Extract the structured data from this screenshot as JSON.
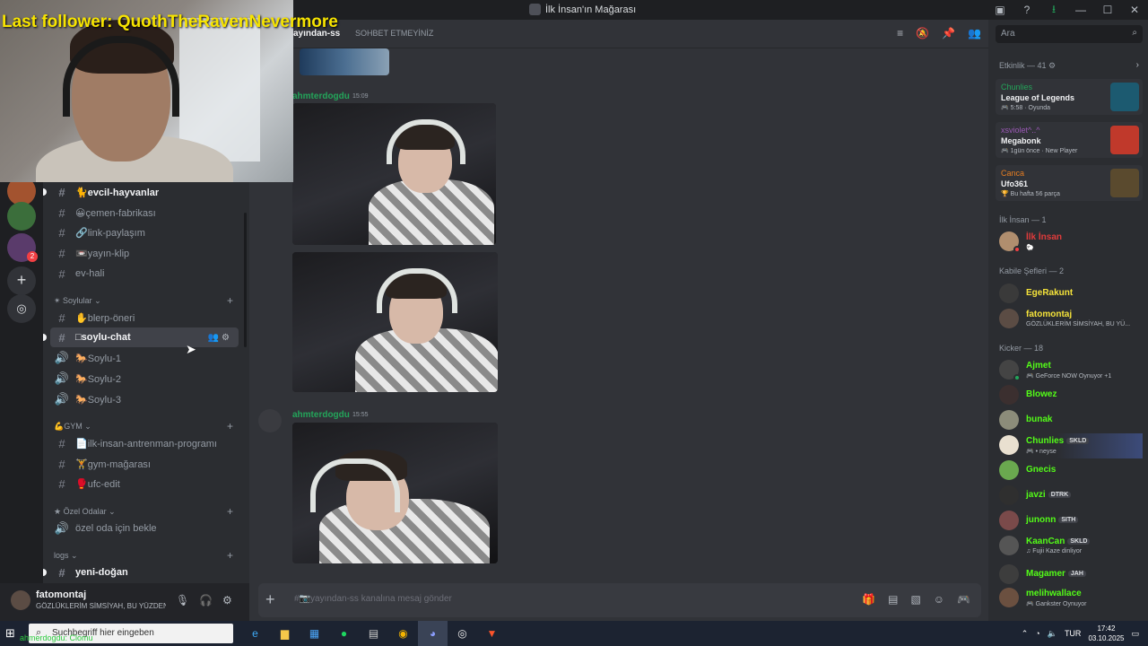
{
  "window": {
    "title": "İlk İnsan'ın Mağarası"
  },
  "overlay": {
    "last_follower": "Last follower: QuothTheRavenNevermore",
    "bottom_text": "ahmerdogdu: Clomu"
  },
  "rail": {
    "badge": "2"
  },
  "channels": [
    {
      "name": "🐈evcil-hayvanlar",
      "type": "text",
      "unread": true
    },
    {
      "name": "😀çemen-fabrikası",
      "type": "text",
      "unread": false
    },
    {
      "name": "🔗link-paylaşım",
      "type": "text",
      "unread": false
    },
    {
      "name": "📼yayın-klip",
      "type": "text",
      "unread": false
    },
    {
      "name": "ev-hali",
      "type": "text",
      "unread": false
    }
  ],
  "categories": {
    "soylular": "✴ Soylular",
    "gym": "💪GYM",
    "ozel": "★ Özel Odalar",
    "logs": "logs"
  },
  "soylular_channels": [
    {
      "name": "✋blerp-öneri",
      "type": "text"
    },
    {
      "name": "□soylu-chat",
      "type": "text",
      "active": true
    },
    {
      "name": "🐎Soylu-1",
      "type": "voice"
    },
    {
      "name": "🐎Soylu-2",
      "type": "voice"
    },
    {
      "name": "🐎Soylu-3",
      "type": "voice"
    }
  ],
  "gym_channels": [
    {
      "name": "📄ilk-insan-antrenman-programı",
      "type": "text"
    },
    {
      "name": "🏋gym-mağarası",
      "type": "text"
    },
    {
      "name": "🥊ufc-edit",
      "type": "text"
    }
  ],
  "ozel_channels": [
    {
      "name": "özel oda için bekle",
      "type": "voice"
    }
  ],
  "logs_channels": [
    {
      "name": "yeni-doğan",
      "type": "text",
      "unread": true
    }
  ],
  "user": {
    "name": "fatomontaj",
    "status": "GÖZLÜKLERİM SİMSİYAH, BU YÜZDEN..."
  },
  "chat": {
    "channel": "ayından-ss",
    "topic": "SOHBET ETMEYİNİZ",
    "messages": [
      {
        "author": "ahmterdogdu",
        "time": "15:09"
      },
      {
        "author": "ahmterdogdu",
        "time": "15:55"
      }
    ],
    "composer_placeholder": "#📷yayından-ss kanalına mesaj gönder"
  },
  "members": {
    "search_placeholder": "Ara",
    "activity_header": "Etkinlik — 41 ⚙",
    "activities": [
      {
        "user": "Chunlies",
        "user_color": "#23a55a",
        "game": "League of Legends",
        "detail": "🎮 5:58 · Oyunda"
      },
      {
        "user": "xsviolet^..^",
        "user_color": "#9b59b6",
        "game": "Megabonk",
        "detail": "🎮 1gün önce · New Player"
      },
      {
        "user": "Canca",
        "user_color": "#e67e22",
        "game": "Ufo361",
        "detail": "🏆 Bu hafta 56 parça"
      }
    ],
    "sections": [
      {
        "title": "İlk İnsan — 1"
      },
      {
        "title": "Kabile Şefleri — 2"
      },
      {
        "title": "Kicker — 18"
      }
    ],
    "ilk_insan": [
      {
        "name": "İlk İnsan",
        "color": "#e03b3b",
        "status": "🐑"
      }
    ],
    "sefler": [
      {
        "name": "EgeRakunt",
        "color": "#f5e33a",
        "status": ""
      },
      {
        "name": "fatomontaj",
        "color": "#f5e33a",
        "status": "GÖZLÜKLERİM SİMSİYAH, BU YÜ..."
      }
    ],
    "kicker": [
      {
        "name": "Ajmet",
        "color": "#53fc18",
        "status": "🎮 GeForce NOW Oynuyor +1",
        "tag": ""
      },
      {
        "name": "Blowez",
        "color": "#53fc18",
        "status": "",
        "tag": ""
      },
      {
        "name": "bunak",
        "color": "#53fc18",
        "status": "",
        "tag": ""
      },
      {
        "name": "Chunlies",
        "color": "#53fc18",
        "status": "🎮 • neyse",
        "tag": "SKLD"
      },
      {
        "name": "Gnecis",
        "color": "#53fc18",
        "status": "",
        "tag": ""
      },
      {
        "name": "javzi",
        "color": "#53fc18",
        "status": "",
        "tag": "DTRK"
      },
      {
        "name": "junonn",
        "color": "#53fc18",
        "status": "",
        "tag": "SITH"
      },
      {
        "name": "KaanCan",
        "color": "#53fc18",
        "status": "♫ Fujii Kaze dinliyor",
        "tag": "SKLD"
      },
      {
        "name": "Magamer",
        "color": "#53fc18",
        "status": "",
        "tag": "JAH"
      },
      {
        "name": "melihwallace",
        "color": "#53fc18",
        "status": "🎮 Gankster Oynuyor",
        "tag": ""
      }
    ]
  },
  "taskbar": {
    "search_placeholder": "Suchbegriff hier eingeben",
    "lang": "TUR",
    "time": "17:42",
    "date": "03.10.2025"
  }
}
